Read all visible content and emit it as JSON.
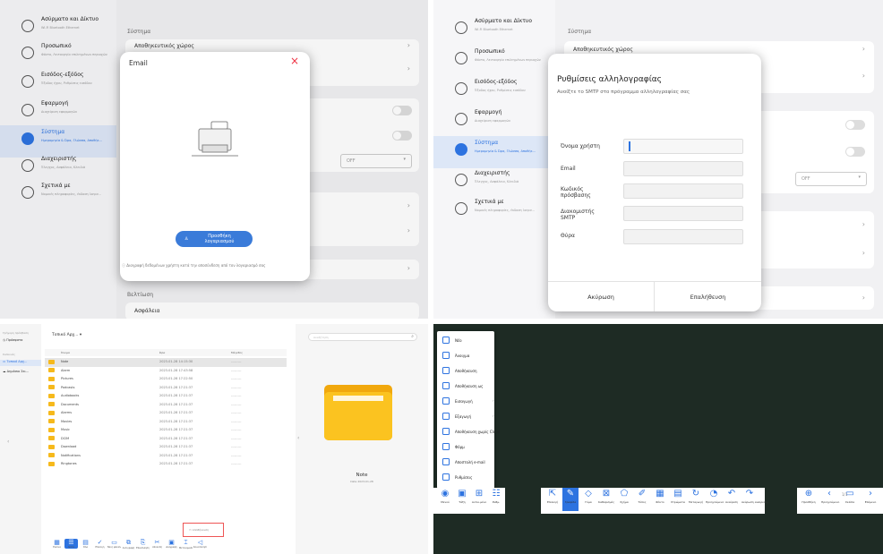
{
  "sidebar_items": [
    {
      "title": "Ασύρματο και Δίκτυο",
      "sub": "Wi-Fi Bluetooth Ethernet",
      "icon": "wifi-icon"
    },
    {
      "title": "Προσωπικό",
      "sub": "Φόντο, Λειτουργία επιλεγμένων περιοχών",
      "icon": "star-icon"
    },
    {
      "title": "Εισόδος-εξόδος",
      "sub": "Έξοδος ήχου, Ρυθμίσεις εισόδου",
      "icon": "swap-icon"
    },
    {
      "title": "Εφαρμογή",
      "sub": "Διαχείριση εφαρμογών",
      "icon": "app-icon"
    },
    {
      "title": "Σύστημα",
      "sub": "Ημερομηνία & Ώρα, Γλώσσα, Αποθήκ...",
      "icon": "monitor-icon"
    },
    {
      "title": "Διαχειριστής",
      "sub": "Έλεγχος, Ασφάλεια, Κλειδιά",
      "icon": "user-icon"
    },
    {
      "title": "Σχετικά με",
      "sub": "Νομικές πληροφορίες, έκδοση λογισ...",
      "icon": "info-icon"
    }
  ],
  "settings": {
    "section": "Σύστημα",
    "storage": "Αποθηκευτικός χώρος",
    "select_value": "OFF",
    "improve_section": "Βελτίωση",
    "security": "Ασφάλεια"
  },
  "email_dialog": {
    "title": "Email",
    "close": "×",
    "button": "Προσθήκη λογαριασμού",
    "note": "Διαγραφή δεδομένων χρήστη κατά την αποσύνδεση από τον λογαριασμό σας"
  },
  "mail_dialog": {
    "title": "Ρυθμίσεις αλληλογραφίας",
    "subtitle": "Ανοίξτε το SMTP στο πρόγραμμα αλληλογραφίας σας",
    "labels": [
      "Όνομα χρήστη",
      "Email",
      "Κωδικός πρόσβασης",
      "Διακομιστής SMTP",
      "Θύρα"
    ],
    "cancel": "Ακύρωση",
    "verify": "Επαλήθευση"
  },
  "file_manager": {
    "recent": "Γρήγορη πρόσβαση",
    "recent_item": "Πρόσφατα",
    "locations": "Συσκευές",
    "loc_local": "Τοπικό Αρχ...",
    "loc_cloud": "Δημόσιο Σκι...",
    "breadcrumb": "Τοπικό Αρχ...",
    "search_placeholder": "Αναζήτηση",
    "columns": [
      "Όνομα",
      "Ώρα",
      "Μέγεθος"
    ],
    "rows": [
      {
        "name": "Note",
        "date": "2023-01-28 14:15:30",
        "size": "---------"
      },
      {
        "name": "Alarm",
        "date": "2023-01-28 17:43:58",
        "size": "---------"
      },
      {
        "name": "Pictures",
        "date": "2023-01-28 17:22:50",
        "size": "---------"
      },
      {
        "name": "Podcasts",
        "date": "2023-01-28 17:21:37",
        "size": "---------"
      },
      {
        "name": "Audiobooks",
        "date": "2023-01-28 17:21:37",
        "size": "---------"
      },
      {
        "name": "Documents",
        "date": "2023-01-28 17:21:37",
        "size": "---------"
      },
      {
        "name": "Alarms",
        "date": "2023-01-28 17:21:37",
        "size": "---------"
      },
      {
        "name": "Movies",
        "date": "2023-01-28 17:21:37",
        "size": "---------"
      },
      {
        "name": "Music",
        "date": "2023-01-28 17:21:37",
        "size": "---------"
      },
      {
        "name": "DCIM",
        "date": "2023-01-28 17:21:37",
        "size": "---------"
      },
      {
        "name": "Download",
        "date": "2023-01-28 17:21:37",
        "size": "---------"
      },
      {
        "name": "Notifications",
        "date": "2023-01-28 17:21:37",
        "size": "---------"
      },
      {
        "name": "Ringtones",
        "date": "2023-01-28 17:21:37",
        "size": "---------"
      }
    ],
    "preview_name": "Note",
    "preview_date": "Date 2023-01-28",
    "popup": "Αποθήκευση",
    "toolbar": [
      "Εικόνα",
      "Λίστα",
      "Όλα",
      "Επιλογή",
      "Νέος φάκελος",
      "Αντιγραφή",
      "Επικόλληση",
      "Αποκοπή",
      "Διαγραφή",
      "Μετονομασία",
      "Κοινοποίηση"
    ]
  },
  "whiteboard": {
    "menu": [
      {
        "label": "Νέο",
        "arrow": false
      },
      {
        "label": "Άνοιγμα",
        "arrow": false
      },
      {
        "label": "Αποθήκευση",
        "arrow": false
      },
      {
        "label": "Αποθήκευση ως",
        "arrow": false
      },
      {
        "label": "Εισαγωγή",
        "arrow": true
      },
      {
        "label": "Εξαγωγή",
        "arrow": true
      },
      {
        "label": "Αποθήκευση χωρίς Cloud",
        "arrow": false
      },
      {
        "label": "Φόρμ",
        "arrow": false
      },
      {
        "label": "Αποστολή e-mail",
        "arrow": false
      },
      {
        "label": "Ρυθμίσεις",
        "arrow": false
      }
    ],
    "left_tools": [
      "Μενού",
      "Τάξη",
      "Αντικ.μένο",
      "Ρυθμ."
    ],
    "mid_tools": [
      "Επιλογή",
      "Γραφίδα",
      "Γόμα",
      "Καθαρισμός",
      "Σχήμα",
      "Τύπος",
      "Φόντο",
      "Στρώματα",
      "Μεταγωγή",
      "Προηγούμενο",
      "Αναίρεση",
      "Ακύρωση αναίρεσης"
    ],
    "right_tools": [
      "Προσθήκη",
      "Προηγούμενο",
      "Σελίδα",
      "Επόμενο"
    ],
    "page": "1/1",
    "bg_color": "#1e2b24",
    "accent": "#2d73e0"
  }
}
